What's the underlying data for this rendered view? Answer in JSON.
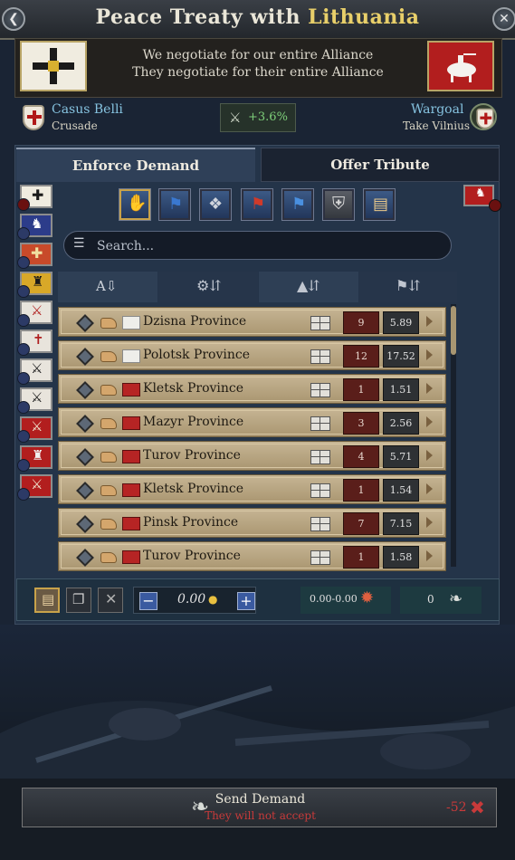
{
  "title": {
    "prefix": "Peace Treaty with",
    "country": "Lithuania"
  },
  "negotiation": {
    "line1": "We negotiate for our entire Alliance",
    "line2": "They negotiate for their entire Alliance"
  },
  "casus_belli": {
    "label": "Casus Belli",
    "value": "Crusade"
  },
  "warscore": "+3.6%",
  "wargoal": {
    "label": "Wargoal",
    "value": "Take Vilnius"
  },
  "tabs": [
    "Enforce Demand",
    "Offer Tribute"
  ],
  "search": {
    "placeholder": "Search..."
  },
  "provinces": [
    {
      "name": "Dzisna Province",
      "flag": "white",
      "cost": "9",
      "value": "5.89"
    },
    {
      "name": "Polotsk Province",
      "flag": "white",
      "cost": "12",
      "value": "17.52"
    },
    {
      "name": "Kletsk Province",
      "flag": "red",
      "cost": "1",
      "value": "1.51"
    },
    {
      "name": "Mazyr Province",
      "flag": "red",
      "cost": "3",
      "value": "2.56"
    },
    {
      "name": "Turov Province",
      "flag": "red",
      "cost": "4",
      "value": "5.71"
    },
    {
      "name": "Kletsk Province",
      "flag": "red",
      "cost": "1",
      "value": "1.54"
    },
    {
      "name": "Pinsk Province",
      "flag": "red",
      "cost": "7",
      "value": "7.15"
    },
    {
      "name": "Turov Province",
      "flag": "red",
      "cost": "1",
      "value": "1.58"
    }
  ],
  "toolbar": {
    "gold": "0.00",
    "range": "0.00-0.00",
    "count": "0"
  },
  "send": {
    "label": "Send Demand",
    "status": "They will not accept",
    "score": "-52"
  },
  "colors": {
    "accent_gold": "#e8cf6a",
    "positive": "#7ed07a",
    "negative": "#c83a3a",
    "link_blue": "#86c3e0"
  }
}
